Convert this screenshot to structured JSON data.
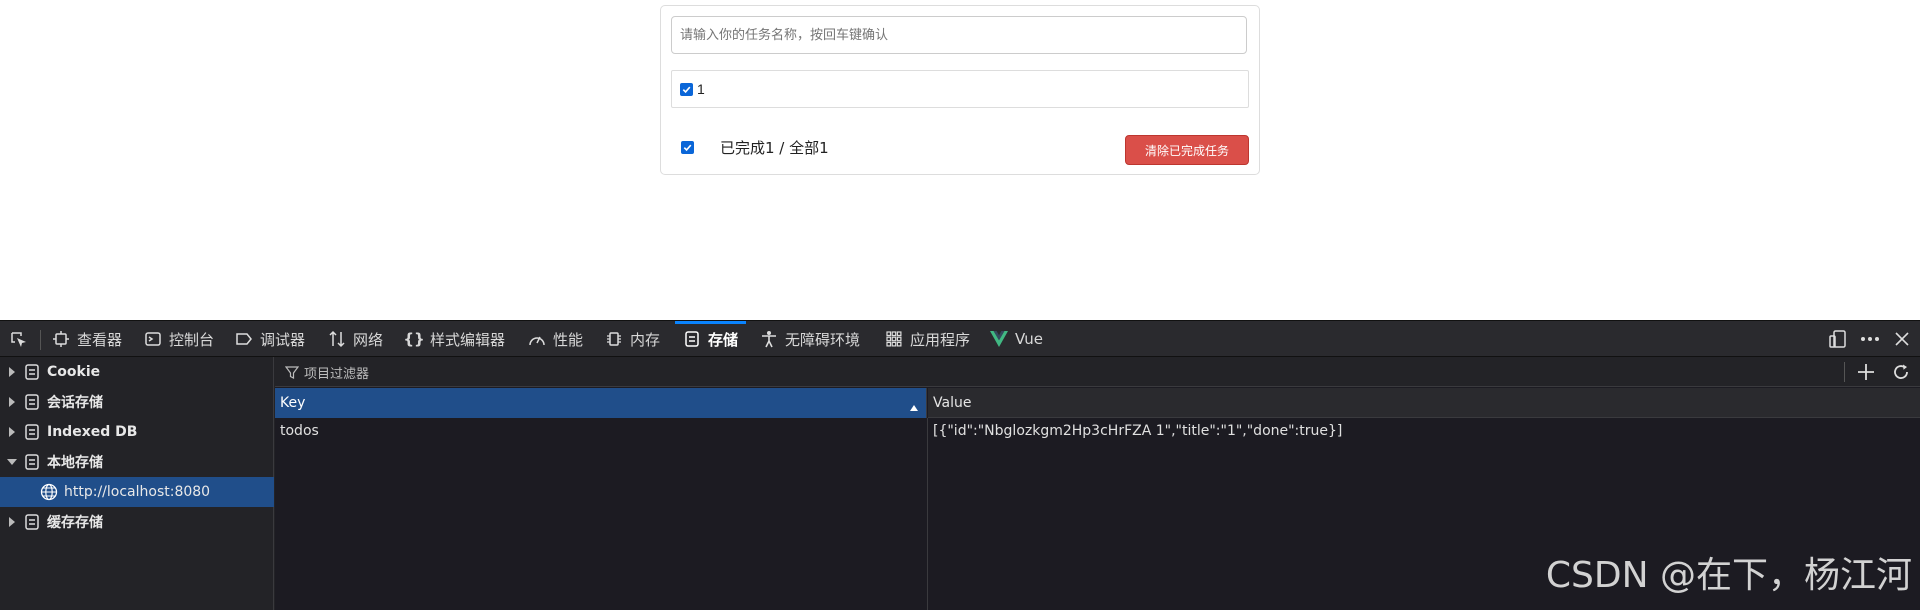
{
  "todo": {
    "input_placeholder": "请输入你的任务名称，按回车键确认",
    "items": [
      {
        "title": "1",
        "done": true
      }
    ],
    "footer_text": "已完成1 / 全部1",
    "check_all": true,
    "clear_button": "清除已完成任务"
  },
  "devtools": {
    "tabs": [
      {
        "label": "查看器",
        "icon": "inspector-icon"
      },
      {
        "label": "控制台",
        "icon": "console-icon"
      },
      {
        "label": "调试器",
        "icon": "debugger-icon"
      },
      {
        "label": "网络",
        "icon": "network-icon"
      },
      {
        "label": "样式编辑器",
        "icon": "style-editor-icon"
      },
      {
        "label": "性能",
        "icon": "performance-icon"
      },
      {
        "label": "内存",
        "icon": "memory-icon"
      },
      {
        "label": "存储",
        "icon": "storage-icon",
        "active": true
      },
      {
        "label": "无障碍环境",
        "icon": "accessibility-icon"
      },
      {
        "label": "应用程序",
        "icon": "application-icon"
      },
      {
        "label": "Vue",
        "icon": "vue-icon"
      }
    ],
    "sidebar": [
      {
        "label": "Cookie",
        "expanded": false
      },
      {
        "label": "会话存储",
        "expanded": false
      },
      {
        "label": "Indexed DB",
        "expanded": false
      },
      {
        "label": "本地存储",
        "expanded": true,
        "children": [
          "http://localhost:8080"
        ]
      },
      {
        "label": "缓存存储",
        "expanded": false
      }
    ],
    "filter_placeholder": "项目过滤器",
    "table": {
      "headers": {
        "key": "Key",
        "value": "Value"
      },
      "rows": [
        {
          "key": "todos",
          "value": "[{\"id\":\"Nbglozkgm2Hp3cHrFZA 1\",\"title\":\"1\",\"done\":true}]"
        }
      ]
    },
    "colors": {
      "accent": "#0a84ff",
      "selected": "#204e8a",
      "vue": "#41b883"
    }
  },
  "watermark": "CSDN @在下，杨江河"
}
